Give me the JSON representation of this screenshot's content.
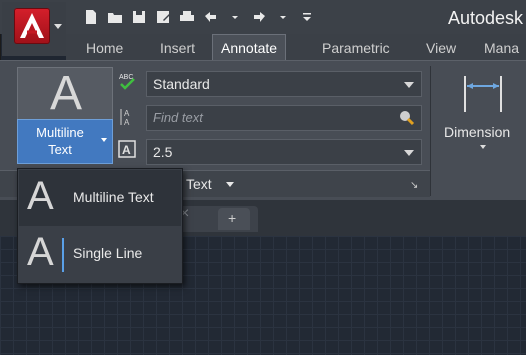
{
  "app": {
    "title": "Autodesk"
  },
  "quick_access": [
    "new-icon",
    "open-icon",
    "save-icon",
    "saveas-icon",
    "print-icon",
    "undo-icon",
    "redo-icon",
    "customize-icon"
  ],
  "tabs": [
    {
      "label": "Home"
    },
    {
      "label": "Insert"
    },
    {
      "label": "Annotate",
      "active": true
    },
    {
      "label": "Parametric"
    },
    {
      "label": "View"
    },
    {
      "label": "Mana"
    }
  ],
  "text_panel": {
    "button_glyph": "A",
    "button_label_line1": "Multiline",
    "button_label_line2": "Text",
    "style_value": "Standard",
    "find_placeholder": "Find text",
    "height_value": "2.5",
    "panel_title": "Text",
    "abc_icon_text": "ABC"
  },
  "dimension": {
    "label": "Dimension"
  },
  "flyout": {
    "items": [
      {
        "glyph": "A",
        "label": "Multiline Text"
      },
      {
        "glyph": "A",
        "label": "Single Line"
      }
    ]
  },
  "file_tabs": {
    "close_symbol": "×",
    "plus_symbol": "+"
  },
  "drawing": {
    "viewport_label": "]"
  },
  "colors": {
    "accent": "#4279c0",
    "logo": "#c41a24",
    "background": "#222934"
  }
}
